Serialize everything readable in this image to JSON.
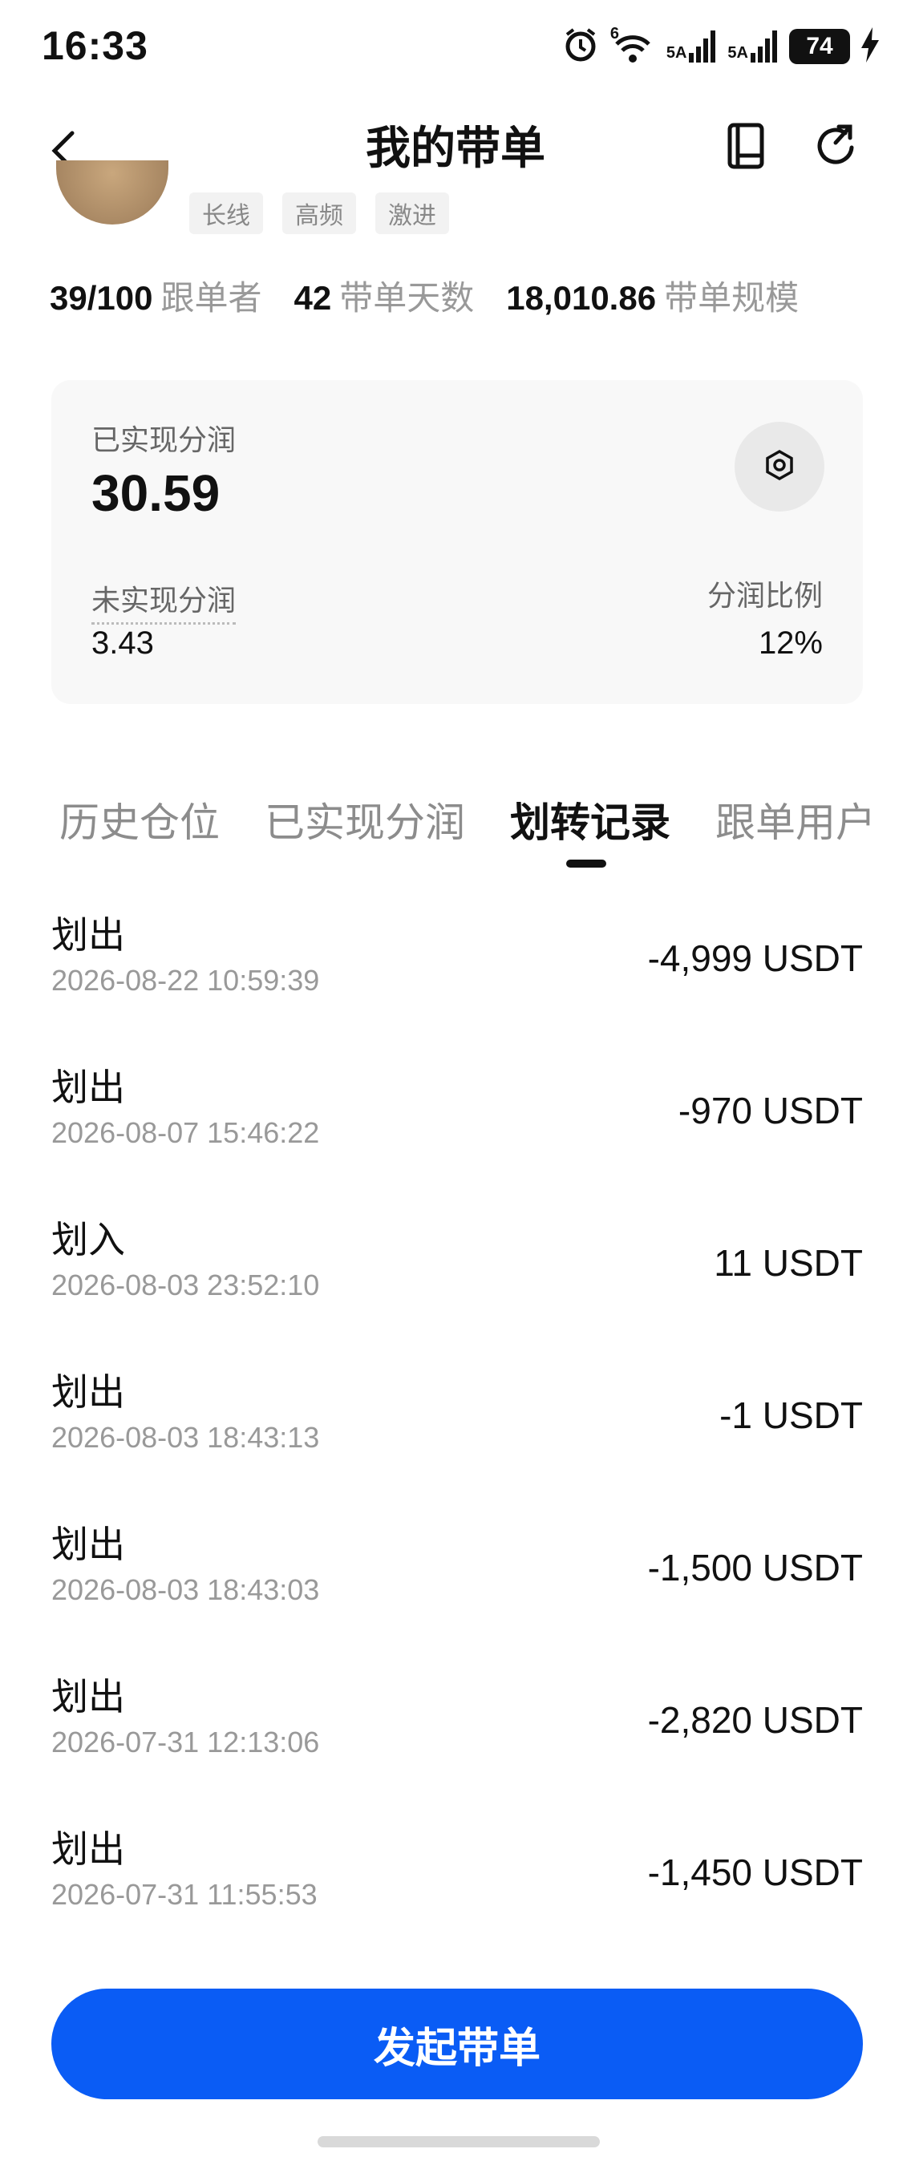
{
  "status_bar": {
    "time": "16:33",
    "wifi_label": "6",
    "signal1_label": "5A",
    "signal2_label": "5A",
    "battery": "74",
    "icons": [
      "alarm-icon",
      "wifi-icon",
      "signal-icon",
      "signal-icon",
      "battery-icon",
      "charging-icon"
    ]
  },
  "nav": {
    "title": "我的带单",
    "icons": [
      "back-icon",
      "book-icon",
      "share-icon"
    ]
  },
  "profile": {
    "tags": [
      "长线",
      "高频",
      "激进"
    ]
  },
  "stats": [
    {
      "value": "39/100",
      "label": "跟单者"
    },
    {
      "value": "42",
      "label": "带单天数"
    },
    {
      "value": "18,010.86",
      "label": "带单规模"
    }
  ],
  "summary": {
    "realized_label": "已实现分润",
    "realized_value": "30.59",
    "unrealized_label": "未实现分润",
    "unrealized_value": "3.43",
    "ratio_label": "分润比例",
    "ratio_value": "12%"
  },
  "tabs": [
    {
      "label": "历史仓位",
      "active": false
    },
    {
      "label": "已实现分润",
      "active": false
    },
    {
      "label": "划转记录",
      "active": true
    },
    {
      "label": "跟单用户",
      "active": false
    }
  ],
  "records": [
    {
      "type": "划出",
      "time": "2026-08-22 10:59:39",
      "amount": "-4,999 USDT"
    },
    {
      "type": "划出",
      "time": "2026-08-07 15:46:22",
      "amount": "-970 USDT"
    },
    {
      "type": "划入",
      "time": "2026-08-03 23:52:10",
      "amount": "11 USDT"
    },
    {
      "type": "划出",
      "time": "2026-08-03 18:43:13",
      "amount": "-1 USDT"
    },
    {
      "type": "划出",
      "time": "2026-08-03 18:43:03",
      "amount": "-1,500 USDT"
    },
    {
      "type": "划出",
      "time": "2026-07-31 12:13:06",
      "amount": "-2,820 USDT"
    },
    {
      "type": "划出",
      "time": "2026-07-31 11:55:53",
      "amount": "-1,450 USDT"
    }
  ],
  "cta_label": "发起带单",
  "colors": {
    "primary": "#0a5cf5",
    "text": "#111111",
    "muted": "#999999",
    "card_bg": "#f8f8f8"
  }
}
